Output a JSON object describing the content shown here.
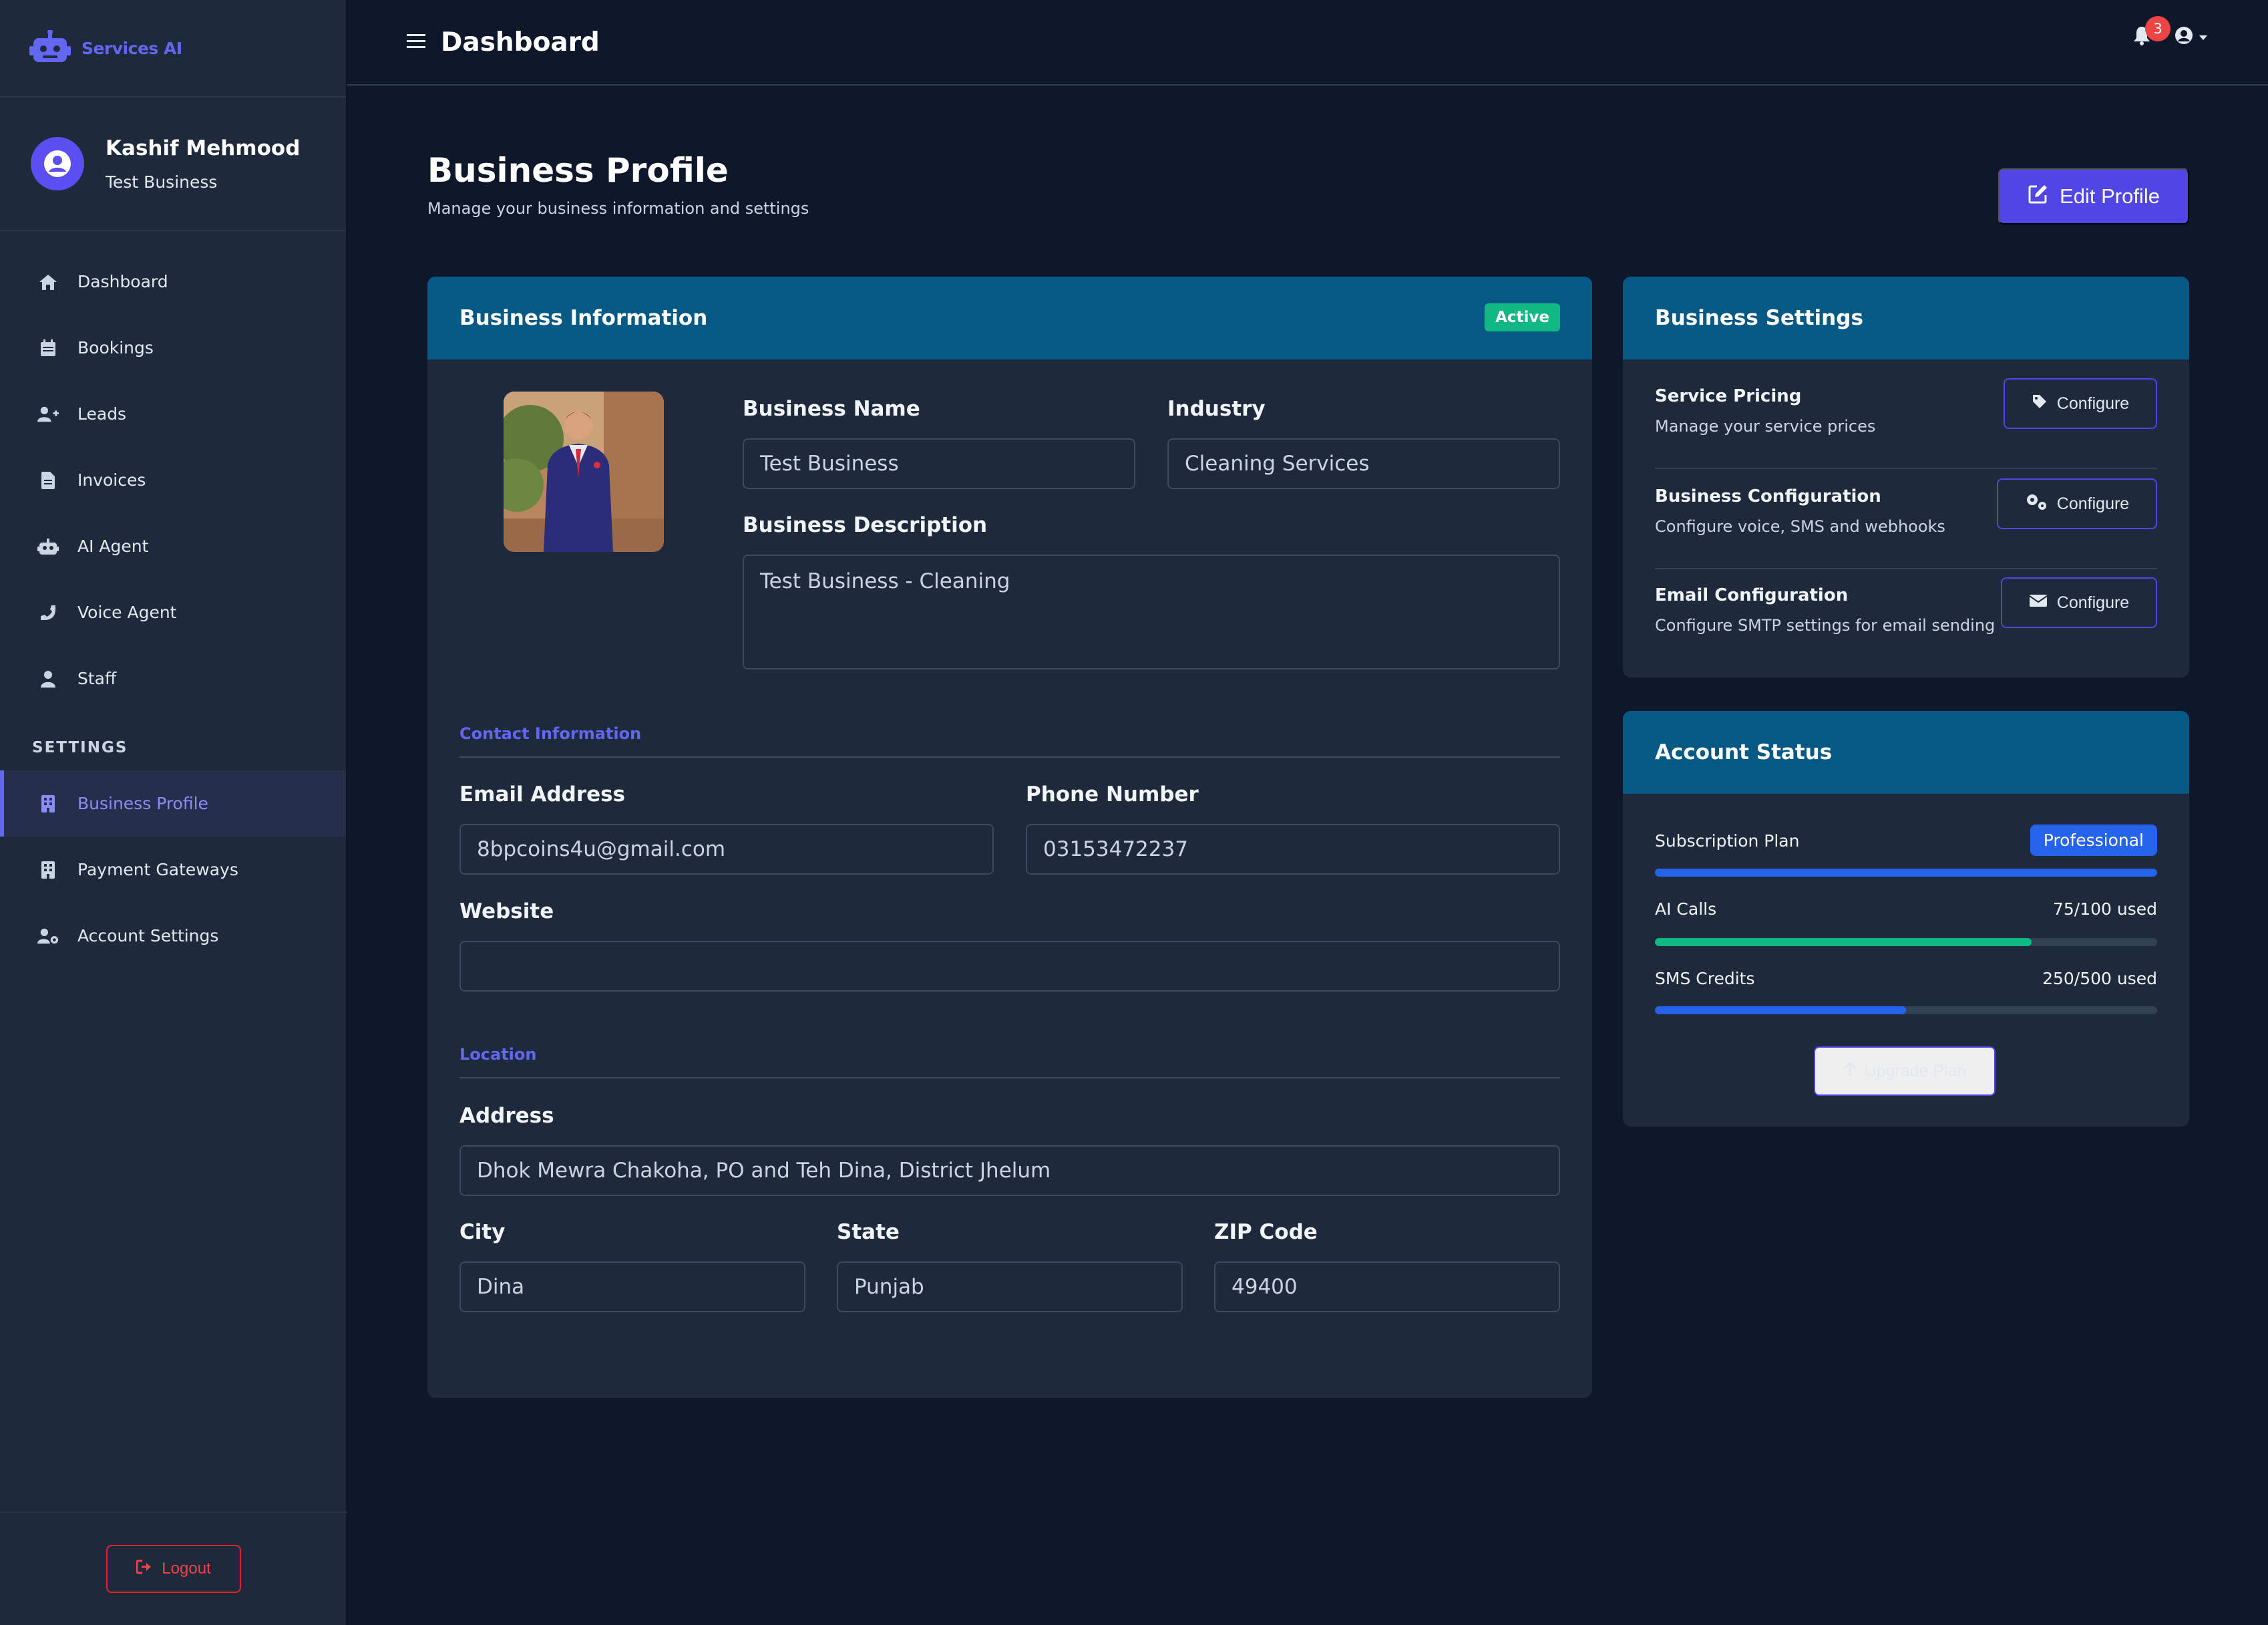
{
  "brand": {
    "name": "Services AI",
    "logo_icon": "robot-icon"
  },
  "user": {
    "name": "Kashif Mehmood",
    "business": "Test Business"
  },
  "nav": {
    "items": [
      {
        "label": "Dashboard",
        "icon": "home-icon"
      },
      {
        "label": "Bookings",
        "icon": "calendar-icon"
      },
      {
        "label": "Leads",
        "icon": "user-plus-icon"
      },
      {
        "label": "Invoices",
        "icon": "file-invoice-icon"
      },
      {
        "label": "AI Agent",
        "icon": "robot-icon"
      },
      {
        "label": "Voice Agent",
        "icon": "phone-icon"
      },
      {
        "label": "Staff",
        "icon": "user-icon"
      }
    ],
    "settings_heading": "SETTINGS",
    "settings_items": [
      {
        "label": "Business Profile",
        "icon": "building-icon",
        "active": true
      },
      {
        "label": "Payment Gateways",
        "icon": "building-icon"
      },
      {
        "label": "Account Settings",
        "icon": "user-gear-icon"
      }
    ],
    "logout_label": "Logout"
  },
  "topbar": {
    "title": "Dashboard",
    "notification_count": "3"
  },
  "page": {
    "title": "Business Profile",
    "subtitle": "Manage your business information and settings",
    "edit_button": "Edit Profile"
  },
  "business_info": {
    "header": "Business Information",
    "status": "Active",
    "business_name_label": "Business Name",
    "business_name": "Test Business",
    "industry_label": "Industry",
    "industry": "Cleaning Services",
    "description_label": "Business Description",
    "description": "Test Business - Cleaning",
    "contact_section": "Contact Information",
    "email_label": "Email Address",
    "email": "8bpcoins4u@gmail.com",
    "phone_label": "Phone Number",
    "phone": "03153472237",
    "website_label": "Website",
    "website": "",
    "location_section": "Location",
    "address_label": "Address",
    "address": "Dhok Mewra Chakoha, PO and Teh Dina, District Jhelum",
    "city_label": "City",
    "city": "Dina",
    "state_label": "State",
    "state": "Punjab",
    "zip_label": "ZIP Code",
    "zip": "49400"
  },
  "business_settings": {
    "header": "Business Settings",
    "rows": [
      {
        "title": "Service Pricing",
        "subtitle": "Manage your service prices",
        "button": "Configure",
        "icon": "tag-icon"
      },
      {
        "title": "Business Configuration",
        "subtitle": "Configure voice, SMS and webhooks",
        "button": "Configure",
        "icon": "gears-icon"
      },
      {
        "title": "Email Configuration",
        "subtitle": "Configure SMTP settings for email sending",
        "button": "Configure",
        "icon": "envelope-icon"
      }
    ]
  },
  "account_status": {
    "header": "Account Status",
    "plan_label": "Subscription Plan",
    "plan": "Professional",
    "plan_fill": 1.0,
    "ai_calls_label": "AI Calls",
    "ai_calls": "75/100 used",
    "ai_calls_fill": 0.75,
    "sms_label": "SMS Credits",
    "sms": "250/500 used",
    "sms_fill": 0.5,
    "upgrade_button": "Upgrade Plan"
  },
  "colors": {
    "accent": "#4f46e5",
    "header_blue": "#075985",
    "success": "#10b981",
    "danger": "#ef4444",
    "progress_blue": "#2563eb",
    "progress_green": "#10b981"
  }
}
